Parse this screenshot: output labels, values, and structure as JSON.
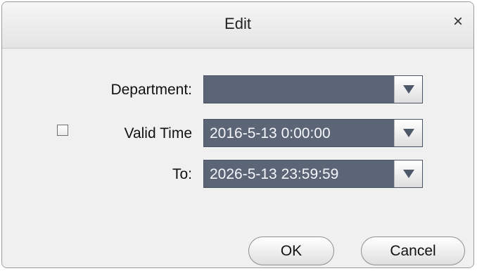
{
  "dialog": {
    "title": "Edit",
    "close_glyph": "×"
  },
  "form": {
    "department_label": "Department:",
    "department_value": "",
    "valid_time_label": "Valid Time",
    "valid_time_checked": false,
    "valid_time_value": "2016-5-13 0:00:00",
    "to_label": "To:",
    "to_value": "2026-5-13 23:59:59"
  },
  "buttons": {
    "ok_label": "OK",
    "cancel_label": "Cancel"
  },
  "icons": {
    "close": "close-icon",
    "dropdown": "chevron-down-icon",
    "checkbox": "checkbox-icon"
  },
  "colors": {
    "combo_bg": "#5b6575",
    "dialog_bg": "#f0f0f0"
  }
}
